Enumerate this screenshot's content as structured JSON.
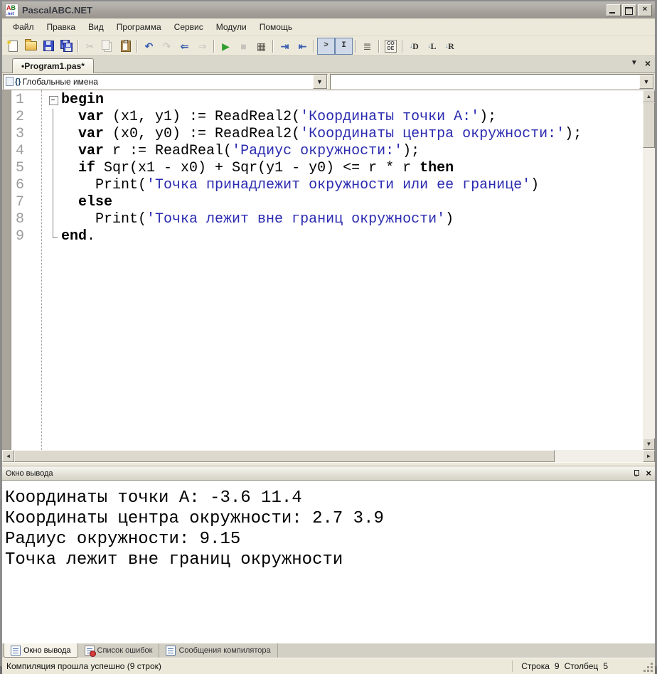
{
  "window": {
    "title": "PascalABC.NET",
    "icon": {
      "top": "AB",
      "bottom": ".net"
    },
    "controls": {
      "minimize": "minimize",
      "maximize": "maximize",
      "close": "×"
    }
  },
  "menu": {
    "items": [
      {
        "name": "file",
        "label": "Файл"
      },
      {
        "name": "edit",
        "label": "Правка"
      },
      {
        "name": "view",
        "label": "Вид"
      },
      {
        "name": "program",
        "label": "Программа"
      },
      {
        "name": "service",
        "label": "Сервис"
      },
      {
        "name": "modules",
        "label": "Модули"
      },
      {
        "name": "help",
        "label": "Помощь"
      }
    ]
  },
  "toolbar": {
    "buttons": [
      {
        "name": "new-file"
      },
      {
        "name": "open-file"
      },
      {
        "name": "save-file"
      },
      {
        "name": "save-all"
      },
      {
        "sep": true
      },
      {
        "name": "cut",
        "disabled": true
      },
      {
        "name": "copy",
        "disabled": true
      },
      {
        "name": "paste"
      },
      {
        "sep": true
      },
      {
        "name": "undo"
      },
      {
        "name": "redo",
        "disabled": true
      },
      {
        "name": "nav-back"
      },
      {
        "name": "nav-forward",
        "disabled": true
      },
      {
        "sep": true
      },
      {
        "name": "run"
      },
      {
        "name": "stop",
        "disabled": true
      },
      {
        "name": "build"
      },
      {
        "sep": true
      },
      {
        "name": "indent-increase"
      },
      {
        "name": "indent-decrease"
      },
      {
        "sep": true
      },
      {
        "name": "console-window-toggle",
        "pressed": true,
        "glyph": ">"
      },
      {
        "name": "text-window-toggle",
        "pressed": true,
        "glyph": "I"
      },
      {
        "sep": true
      },
      {
        "name": "format-source"
      },
      {
        "sep": true
      },
      {
        "name": "code-templates",
        "glyph": "CODE"
      },
      {
        "sep": true
      },
      {
        "name": "insert-d",
        "glyph": "D"
      },
      {
        "name": "insert-l",
        "glyph": "L"
      },
      {
        "name": "insert-r",
        "glyph": "R"
      }
    ]
  },
  "tabbar": {
    "bullet": "•",
    "label": "Program1.pas*",
    "chevron": "▼",
    "close": "×"
  },
  "navigator": {
    "scope_combo": {
      "braces": "{}",
      "value": "Глобальные имена",
      "arrow": "▼"
    },
    "member_combo": {
      "value": "",
      "arrow": "▼"
    }
  },
  "editor": {
    "lines": [
      {
        "num": "1",
        "fold": "start",
        "tokens": [
          [
            "kw",
            "begin"
          ]
        ]
      },
      {
        "num": "2",
        "fold": "line",
        "tokens": [
          [
            "pl",
            "  "
          ],
          [
            "kw",
            "var"
          ],
          [
            "pl",
            " (x1, y1) := ReadReal2("
          ],
          [
            "str",
            "'Координаты точки A:'"
          ],
          [
            "pl",
            ");"
          ]
        ]
      },
      {
        "num": "3",
        "fold": "line",
        "tokens": [
          [
            "pl",
            "  "
          ],
          [
            "kw",
            "var"
          ],
          [
            "pl",
            " (x0, y0) := ReadReal2("
          ],
          [
            "str",
            "'Координаты центра окружности:'"
          ],
          [
            "pl",
            ");"
          ]
        ]
      },
      {
        "num": "4",
        "fold": "line",
        "tokens": [
          [
            "pl",
            "  "
          ],
          [
            "kw",
            "var"
          ],
          [
            "pl",
            " r := ReadReal("
          ],
          [
            "str",
            "'Радиус окружности:'"
          ],
          [
            "pl",
            ");"
          ]
        ]
      },
      {
        "num": "5",
        "fold": "line",
        "tokens": [
          [
            "pl",
            "  "
          ],
          [
            "kw",
            "if"
          ],
          [
            "pl",
            " Sqr(x1 - x0) + Sqr(y1 - y0) <= r * r "
          ],
          [
            "kw",
            "then"
          ]
        ]
      },
      {
        "num": "6",
        "fold": "line",
        "tokens": [
          [
            "pl",
            "    Print("
          ],
          [
            "str",
            "'Точка принадлежит окружности или ее границе'"
          ],
          [
            "pl",
            ")"
          ]
        ]
      },
      {
        "num": "7",
        "fold": "line",
        "tokens": [
          [
            "pl",
            "  "
          ],
          [
            "kw",
            "else"
          ]
        ]
      },
      {
        "num": "8",
        "fold": "line",
        "tokens": [
          [
            "pl",
            "    Print("
          ],
          [
            "str",
            "'Точка лежит вне границ окружности'"
          ],
          [
            "pl",
            ")"
          ]
        ]
      },
      {
        "num": "9",
        "fold": "end",
        "tokens": [
          [
            "kw",
            "end"
          ],
          [
            "pl",
            "."
          ]
        ]
      }
    ]
  },
  "output_panel": {
    "title": "Окно вывода",
    "close": "×",
    "lines": [
      "Координаты точки A: -3.6 11.4",
      "Координаты центра окружности: 2.7 3.9",
      "Радиус окружности: 9.15",
      "Точка лежит вне границ окружности"
    ]
  },
  "bottom_tabs": [
    {
      "name": "output-window",
      "label": "Окно вывода",
      "active": true,
      "icon": "list"
    },
    {
      "name": "error-list",
      "label": "Список ошибок",
      "active": false,
      "icon": "error"
    },
    {
      "name": "compiler-messages",
      "label": "Сообщения компилятора",
      "active": false,
      "icon": "list"
    }
  ],
  "status_bar": {
    "message": "Компиляция прошла успешно (9 строк)",
    "line_label": "Строка",
    "line": "9",
    "col_label": "Столбец",
    "col": "5"
  },
  "colors": {
    "string": "#2a2ab0",
    "keyword": "#000000",
    "line_number": "#9c9c9c",
    "run_green": "#2f9e2f",
    "ui_beige": "#ece9da",
    "titlebar_gray": "#a6a29b"
  }
}
